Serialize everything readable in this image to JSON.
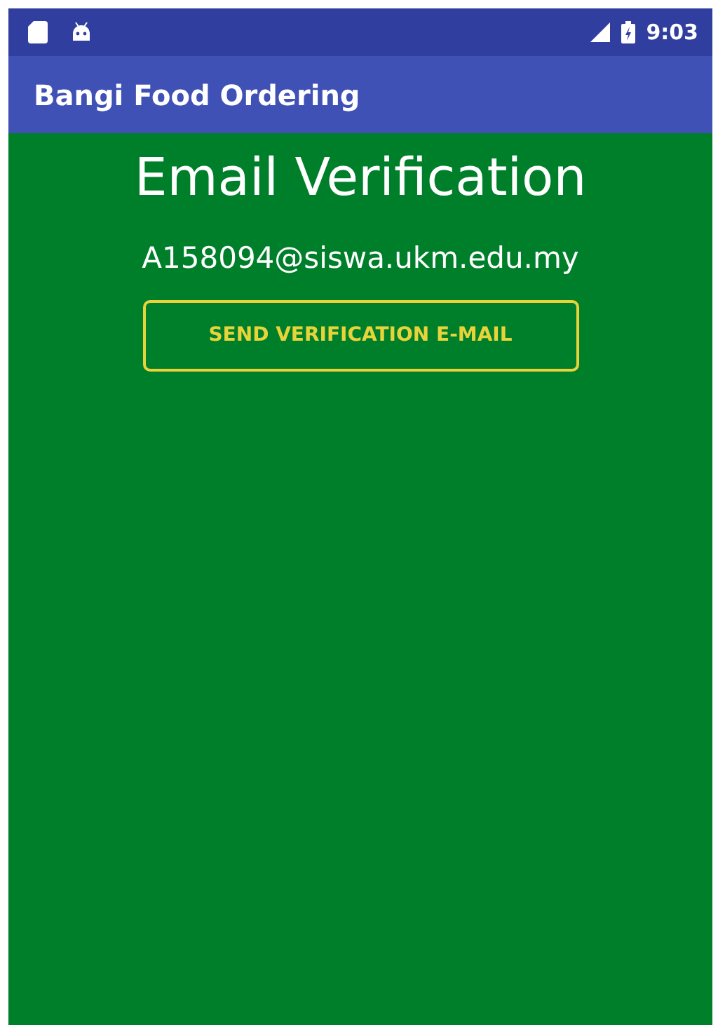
{
  "status_bar": {
    "time": "9:03"
  },
  "app_bar": {
    "title": "Bangi Food Ordering"
  },
  "content": {
    "heading": "Email Verification",
    "email": "A158094@siswa.ukm.edu.my",
    "button": "SEND VERIFICATION E-MAIL"
  }
}
